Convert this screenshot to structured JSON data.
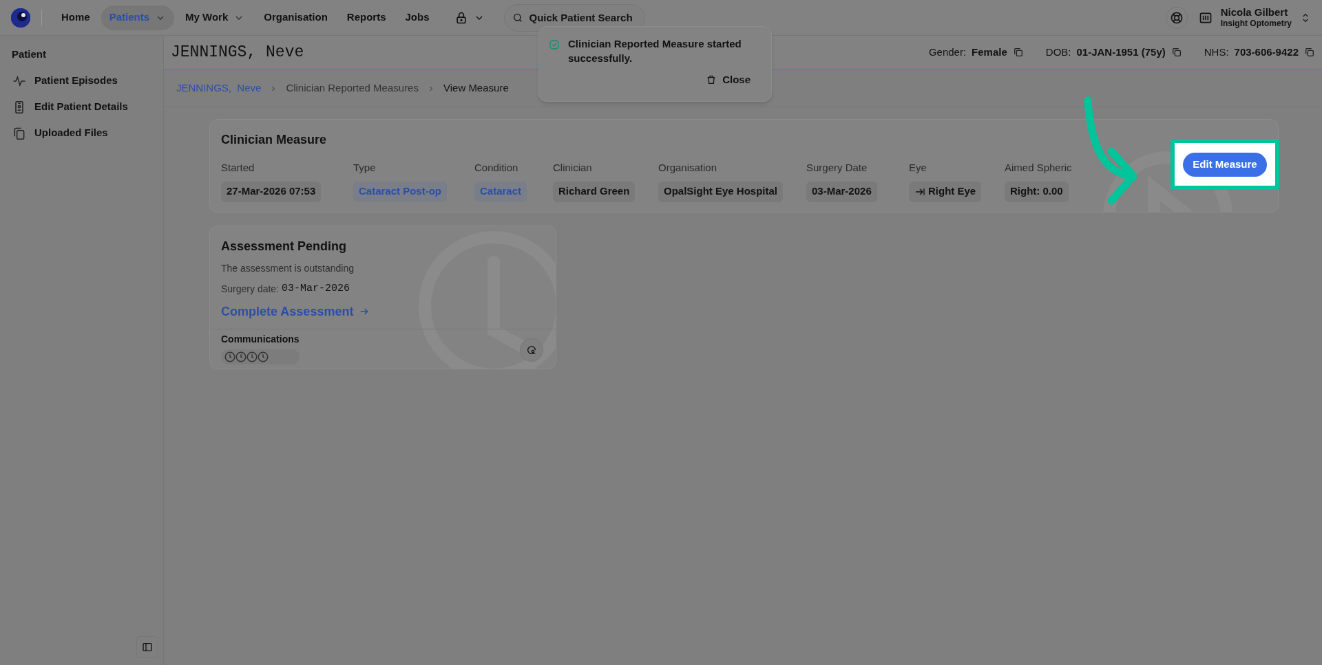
{
  "nav": {
    "items": [
      {
        "label": "Home",
        "selected": false,
        "dropdown": false
      },
      {
        "label": "Patients",
        "selected": true,
        "dropdown": true
      },
      {
        "label": "My Work",
        "selected": false,
        "dropdown": true
      },
      {
        "label": "Organisation",
        "selected": false,
        "dropdown": false
      },
      {
        "label": "Reports",
        "selected": false,
        "dropdown": false
      },
      {
        "label": "Jobs",
        "selected": false,
        "dropdown": false
      }
    ],
    "search": {
      "placeholder": "Quick Patient Search"
    },
    "user": {
      "name": "Nicola Gilbert",
      "org": "Insight Optometry"
    }
  },
  "sidebar": {
    "heading": "Patient",
    "items": [
      {
        "label": "Patient Episodes",
        "kind": "pulse"
      },
      {
        "label": "Edit Patient Details",
        "kind": "badge"
      },
      {
        "label": "Uploaded Files",
        "kind": "files"
      }
    ]
  },
  "patient": {
    "name": "JENNINGS, Neve",
    "fields": [
      {
        "label": "Gender:",
        "value": "Female"
      },
      {
        "label": "DOB:",
        "value": "01-JAN-1951 (75y)"
      },
      {
        "label": "NHS:",
        "value": "703-606-9422"
      }
    ]
  },
  "breadcrumb": [
    {
      "label": "JENNINGS,  Neve",
      "kind": "link"
    },
    {
      "label": "Clinician Reported Measures",
      "kind": "muted"
    },
    {
      "label": "View Measure",
      "kind": "current"
    }
  ],
  "toast": {
    "message": "Clinician Reported Measure started successfully.",
    "close": "Close"
  },
  "measure": {
    "title": "Clinician Measure",
    "fields": [
      {
        "label": "Started",
        "value": "27-Mar-2026 07:53",
        "kind": "plain"
      },
      {
        "label": "Type",
        "value": "Cataract Post-op",
        "kind": "link"
      },
      {
        "label": "Condition",
        "value": "Cataract",
        "kind": "link"
      },
      {
        "label": "Clinician",
        "value": "Richard Green",
        "kind": "plain"
      },
      {
        "label": "Organisation",
        "value": "OpalSight Eye Hospital",
        "kind": "plain"
      },
      {
        "label": "Surgery Date",
        "value": "03-Mar-2026",
        "kind": "plain"
      },
      {
        "label": "Eye",
        "value": "Right Eye",
        "kind": "eye"
      },
      {
        "label": "Aimed Spheric",
        "value": "Right: 0.00",
        "kind": "plain"
      }
    ],
    "button": "Edit Measure"
  },
  "assessment": {
    "title": "Assessment Pending",
    "description": "The assessment is outstanding",
    "surgery_label": "Surgery date:",
    "surgery_date": "03-Mar-2026",
    "link": "Complete Assessment",
    "communications": "Communications"
  }
}
